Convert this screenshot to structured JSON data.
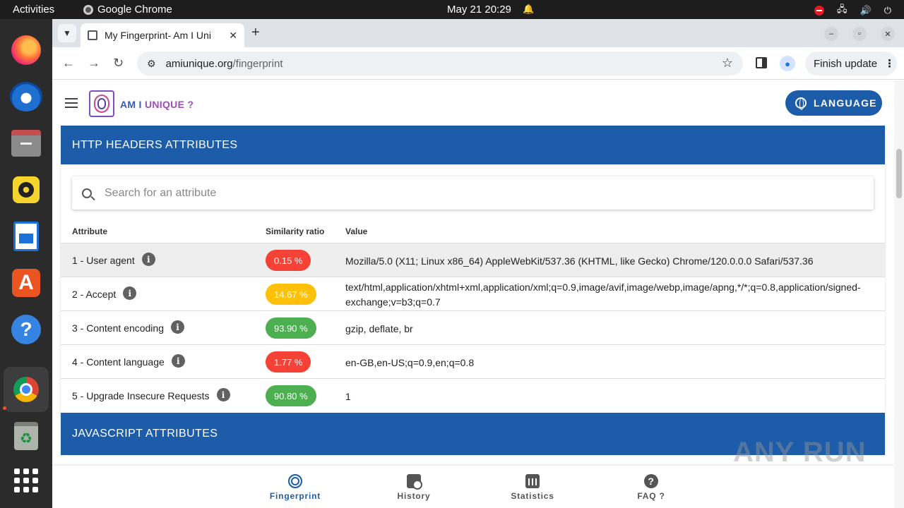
{
  "desktop": {
    "activities": "Activities",
    "app_name": "Google Chrome",
    "clock": "May 21  20:29"
  },
  "browser": {
    "tab_title": "My Fingerprint- Am I Uni",
    "url_host": "amiunique.org",
    "url_path": "/fingerprint",
    "finish_update": "Finish update"
  },
  "site": {
    "brand_part1": "AM I ",
    "brand_part2": "UNIQUE ?",
    "language_button": "LANGUAGE"
  },
  "http_section": {
    "title": "HTTP HEADERS ATTRIBUTES",
    "search_placeholder": "Search for an attribute",
    "columns": {
      "attribute": "Attribute",
      "similarity": "Similarity ratio",
      "value": "Value"
    },
    "rows": [
      {
        "attribute": "1 - User agent",
        "ratio": "0.15 %",
        "ratio_color": "#f44336",
        "value": "Mozilla/5.0 (X11; Linux x86_64) AppleWebKit/537.36 (KHTML, like Gecko) Chrome/120.0.0.0 Safari/537.36"
      },
      {
        "attribute": "2 - Accept",
        "ratio": "14.67 %",
        "ratio_color": "#ffc107",
        "value": "text/html,application/xhtml+xml,application/xml;q=0.9,image/avif,image/webp,image/apng,*/*;q=0.8,application/signed-exchange;v=b3;q=0.7"
      },
      {
        "attribute": "3 - Content encoding",
        "ratio": "93.90 %",
        "ratio_color": "#4caf50",
        "value": "gzip, deflate, br"
      },
      {
        "attribute": "4 - Content language",
        "ratio": "1.77 %",
        "ratio_color": "#f44336",
        "value": "en-GB,en-US;q=0.9,en;q=0.8"
      },
      {
        "attribute": "5 - Upgrade Insecure Requests",
        "ratio": "90.80 %",
        "ratio_color": "#4caf50",
        "value": "1"
      }
    ]
  },
  "js_section": {
    "title": "JAVASCRIPT ATTRIBUTES"
  },
  "bottom_nav": {
    "fingerprint": "Fingerprint",
    "history": "History",
    "statistics": "Statistics",
    "faq": "FAQ ?"
  },
  "watermark": "ANY RUN"
}
